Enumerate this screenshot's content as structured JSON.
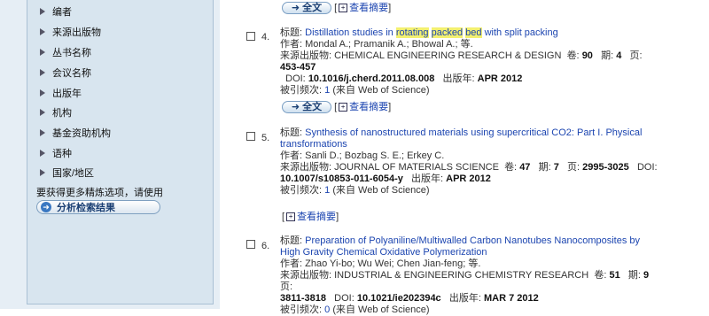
{
  "sidebar": {
    "facets": [
      {
        "label": "编者"
      },
      {
        "label": "来源出版物"
      },
      {
        "label": "丛书名称"
      },
      {
        "label": "会议名称"
      },
      {
        "label": "出版年"
      },
      {
        "label": "机构"
      },
      {
        "label": "基金资助机构"
      },
      {
        "label": "语种"
      },
      {
        "label": "国家/地区"
      }
    ],
    "refine_note": "要获得更多精炼选项，请使用",
    "analyze_button": "分析检索结果"
  },
  "buttons": {
    "full_text": "全文",
    "view_abstract": "查看摘要"
  },
  "labels": {
    "title": "标题:",
    "author": "作者:",
    "source": "来源出版物:",
    "volume": "卷:",
    "issue": "期:",
    "pages": "页:",
    "doi": "DOI:",
    "pubyear": "出版年:",
    "cited": "被引频次:",
    "from_wos": "(来自 Web of Science)"
  },
  "records": [
    {
      "number": "4.",
      "title_parts": [
        "Distillation studies in ",
        "rotating",
        " ",
        "packed",
        " ",
        "bed",
        " with split packing"
      ],
      "authors": "Mondal A.; Pramanik A.; Bhowal A.; 等.",
      "source": "CHEMICAL ENGINEERING RESEARCH & DESIGN",
      "volume": "90",
      "issue": "4",
      "pages": "453-457",
      "doi": "10.1016/j.cherd.2011.08.008",
      "pubyear": "APR 2012",
      "cited": "1"
    },
    {
      "number": "5.",
      "title_line1": "Synthesis of nanostructured materials using supercritical CO2: Part I. Physical",
      "title_line2": "transformations",
      "authors": "Sanli D.; Bozbag S. E.; Erkey C.",
      "source": "JOURNAL OF MATERIALS SCIENCE",
      "volume": "47",
      "issue": "7",
      "pages": "2995-3025",
      "doi": "10.1007/s10853-011-6054-y",
      "pubyear": "APR 2012",
      "cited": "1"
    },
    {
      "number": "6.",
      "title_line1": "Preparation of Polyaniline/Multiwalled Carbon Nanotubes Nanocomposites by",
      "title_line2": "High Gravity Chemical Oxidative Polymerization",
      "authors": "Zhao Yi-bo; Wu Wei; Chen Jian-feng; 等.",
      "source": "INDUSTRIAL & ENGINEERING CHEMISTRY RESEARCH",
      "volume": "51",
      "issue": "9",
      "pages": "3811-3818",
      "doi": "10.1021/ie202394c",
      "pubyear": "MAR 7 2012",
      "cited": "0"
    }
  ]
}
